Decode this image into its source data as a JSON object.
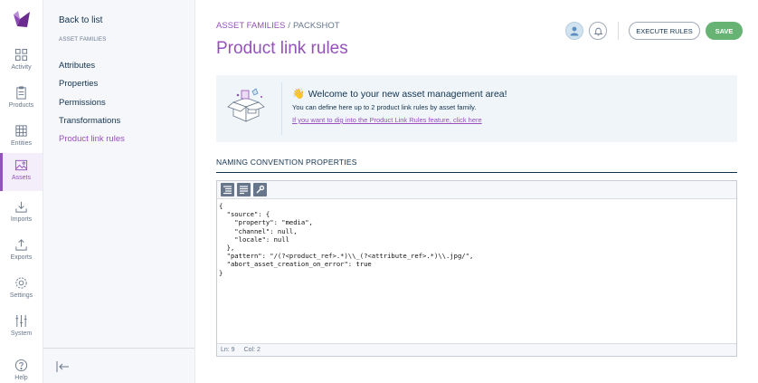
{
  "mainnav": {
    "items": [
      {
        "key": "activity",
        "label": "Activity",
        "icon": "activity-icon"
      },
      {
        "key": "products",
        "label": "Products",
        "icon": "products-icon"
      },
      {
        "key": "entities",
        "label": "Entities",
        "icon": "entities-icon"
      },
      {
        "key": "assets",
        "label": "Assets",
        "icon": "assets-icon",
        "active": true
      },
      {
        "key": "imports",
        "label": "Imports",
        "icon": "imports-icon"
      },
      {
        "key": "exports",
        "label": "Exports",
        "icon": "exports-icon"
      },
      {
        "key": "settings",
        "label": "Settings",
        "icon": "settings-icon"
      },
      {
        "key": "system",
        "label": "System",
        "icon": "system-icon"
      },
      {
        "key": "help",
        "label": "Help",
        "icon": "help-icon"
      }
    ]
  },
  "subpanel": {
    "back_label": "Back to list",
    "section_label": "ASSET FAMILIES",
    "items": [
      {
        "label": "Attributes"
      },
      {
        "label": "Properties"
      },
      {
        "label": "Permissions"
      },
      {
        "label": "Transformations"
      },
      {
        "label": "Product link rules",
        "active": true
      }
    ]
  },
  "header": {
    "breadcrumb_parent": "ASSET FAMILIES",
    "breadcrumb_separator": "/",
    "breadcrumb_current": "PACKSHOT",
    "title": "Product link rules",
    "execute_label": "EXECUTE RULES",
    "save_label": "SAVE"
  },
  "helper": {
    "wave": "👋",
    "welcome": "Welcome to your new asset management area!",
    "description": "You can define here up to 2 product link rules by asset family.",
    "link": "If you want to dig into the Product Link Rules feature, click here"
  },
  "section": {
    "title": "NAMING CONVENTION PROPERTIES"
  },
  "editor": {
    "code": "{\n  \"source\": {\n    \"property\": \"media\",\n    \"channel\": null,\n    \"locale\": null\n  },\n  \"pattern\": \"/(?<product_ref>.*)\\\\_(?<attribute_ref>.*)\\\\.jpg/\",\n  \"abort_asset_creation_on_error\": true\n}",
    "status_line": "Ln: 9",
    "status_col": "Col: 2"
  },
  "colors": {
    "brand": "#9452ba",
    "save_green": "#67b373",
    "text": "#11324d",
    "muted": "#67768a"
  }
}
